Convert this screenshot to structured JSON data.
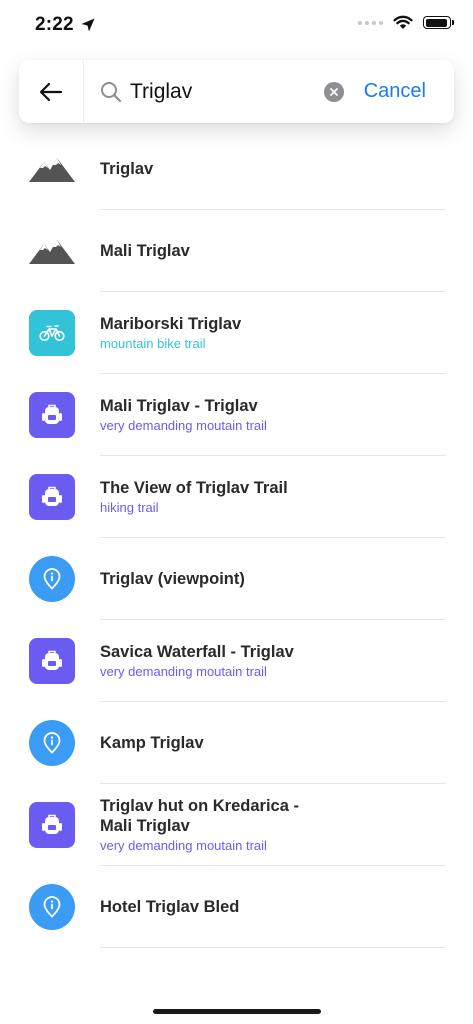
{
  "status_bar": {
    "time": "2:22",
    "battery_level": 0.95
  },
  "search": {
    "query": "Triglav",
    "cancel_label": "Cancel"
  },
  "colors": {
    "accent_blue": "#1a7cf0",
    "bike_teal": "#33c3d8",
    "trail_purple": "#6a5cf0",
    "poi_blue": "#3a9cf5",
    "peak_gray": "#545454"
  },
  "results": [
    {
      "icon": "mountain-peak-icon",
      "type": "peak",
      "title": "Triglav",
      "subtitle": ""
    },
    {
      "icon": "mountain-peak-icon",
      "type": "peak",
      "title": "Mali Triglav",
      "subtitle": ""
    },
    {
      "icon": "bicycle-icon",
      "type": "bike",
      "title": "Mariborski Triglav",
      "subtitle": "mountain bike trail"
    },
    {
      "icon": "backpack-icon",
      "type": "trail",
      "title": "Mali Triglav - Triglav",
      "subtitle": "very demanding moutain trail"
    },
    {
      "icon": "backpack-icon",
      "type": "trail",
      "title": "The View of Triglav Trail",
      "subtitle": "hiking trail"
    },
    {
      "icon": "info-pin-icon",
      "type": "poi",
      "title": "Triglav (viewpoint)",
      "subtitle": ""
    },
    {
      "icon": "backpack-icon",
      "type": "trail",
      "title": "Savica Waterfall - Triglav",
      "subtitle": "very demanding moutain trail"
    },
    {
      "icon": "info-pin-icon",
      "type": "poi",
      "title": "Kamp Triglav",
      "subtitle": ""
    },
    {
      "icon": "backpack-icon",
      "type": "trail",
      "title": "Triglav hut on Kredarica -\nMali Triglav",
      "subtitle": "very demanding moutain trail"
    },
    {
      "icon": "info-pin-icon",
      "type": "poi",
      "title": "Hotel Triglav Bled",
      "subtitle": ""
    }
  ]
}
